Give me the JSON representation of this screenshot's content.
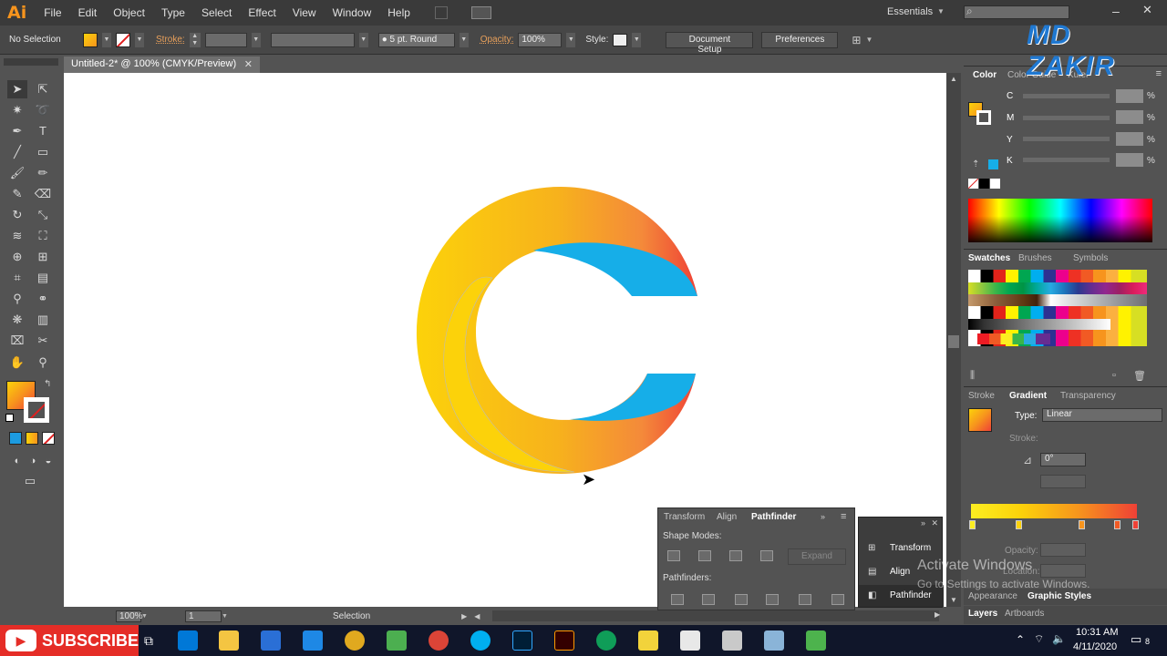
{
  "app": {
    "logo": "Ai",
    "workspace": "Essentials"
  },
  "menu": [
    "File",
    "Edit",
    "Object",
    "Type",
    "Select",
    "Effect",
    "View",
    "Window",
    "Help"
  ],
  "control": {
    "selection": "No Selection",
    "stroke_label": "Stroke:",
    "brush": "5 pt. Round",
    "opacity_label": "Opacity:",
    "opacity": "100%",
    "style_label": "Style:",
    "doc_setup": "Document Setup",
    "preferences": "Preferences"
  },
  "doc_tab": {
    "title": "Untitled-2* @ 100% (CMYK/Preview)"
  },
  "status": {
    "zoom": "100%",
    "page": "1",
    "tool": "Selection"
  },
  "color_panel": {
    "tabs": [
      "Color",
      "Color Guide",
      "Kuler"
    ],
    "rows": [
      {
        "label": "C"
      },
      {
        "label": "M"
      },
      {
        "label": "Y"
      },
      {
        "label": "K"
      }
    ],
    "pct": "%"
  },
  "swatches_panel": {
    "tabs": [
      "Swatches",
      "Brushes",
      "Symbols"
    ]
  },
  "gradient_panel": {
    "tabs": [
      "Stroke",
      "Gradient",
      "Transparency"
    ],
    "type_label": "Type:",
    "type": "Linear",
    "stroke_label": "Stroke:",
    "angle": "0°",
    "opacity_label": "Opacity:",
    "location_label": "Location:"
  },
  "bottom_tabs": {
    "appearance": "Appearance",
    "graphic_styles": "Graphic Styles",
    "layers": "Layers",
    "artboards": "Artboards"
  },
  "pathfinder": {
    "tabs": [
      "Transform",
      "Align",
      "Pathfinder"
    ],
    "shape_modes": "Shape Modes:",
    "expand": "Expand",
    "pathfinders": "Pathfinders:"
  },
  "dock": [
    "Transform",
    "Align",
    "Pathfinder"
  ],
  "activation": {
    "title": "Activate Windows",
    "sub": "Go to Settings to activate Windows."
  },
  "watermark": "MD ZAKIR",
  "subscribe": "SUBSCRIBE",
  "clock": {
    "time": "10:31 AM",
    "date": "4/11/2020",
    "notif": "8"
  },
  "colors": {
    "orange": "#f7941d",
    "yellow": "#fcd20a",
    "red": "#ef4136",
    "blue": "#16aee8"
  }
}
